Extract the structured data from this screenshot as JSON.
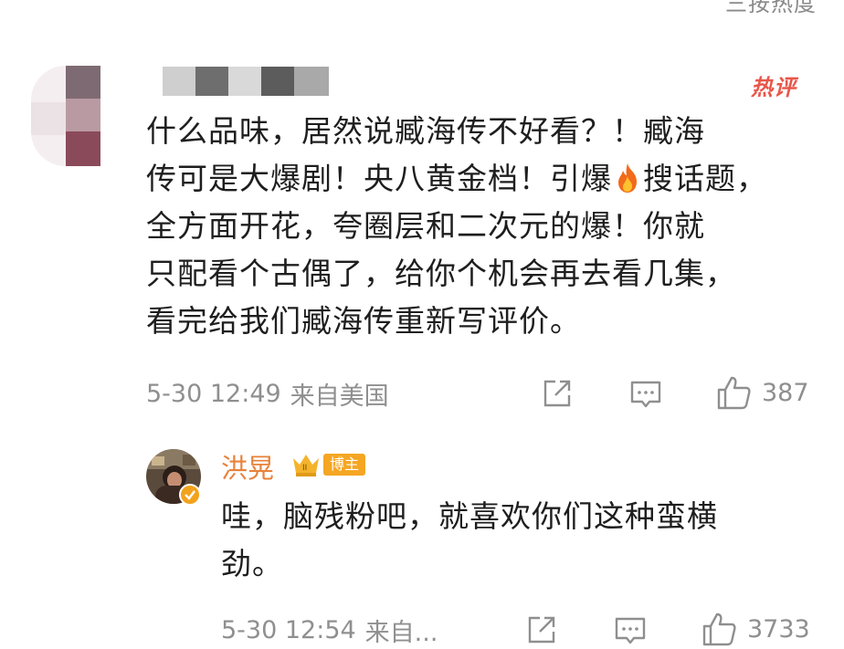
{
  "header": {
    "sort_hint": "三按热度"
  },
  "comment": {
    "hot_badge": "热评",
    "lines": [
      "什么品味，居然说臧海传不好看？！臧海",
      "传可是大爆剧！央八黄金档！引爆",
      "全方面开花，夸圈层和二次元的爆！你就",
      "只配看个古偶了，给你个机会再去看几集，",
      "看完给我们臧海传重新写评价。"
    ],
    "line2_after_icon": "搜话题，",
    "timestamp": "5-30 12:49",
    "location": "来自美国",
    "like_count": "387"
  },
  "reply": {
    "username": "洪晃",
    "host_tag": "博主",
    "text_lines": [
      "哇，脑残粉吧，就喜欢你们这种蛮横",
      "劲。"
    ],
    "timestamp": "5-30 12:54",
    "location": "来自...",
    "like_count": "3733"
  },
  "colors": {
    "hot": "#e8574a",
    "username": "#e8813a",
    "meta": "#8f8f8f",
    "host_tag_bg": "#f5a623"
  },
  "icons": {
    "fire": "fire-icon",
    "share": "share-icon",
    "comment": "comment-icon",
    "like": "thumbs-up-icon",
    "crown": "crown-icon",
    "verified": "verified-icon"
  }
}
